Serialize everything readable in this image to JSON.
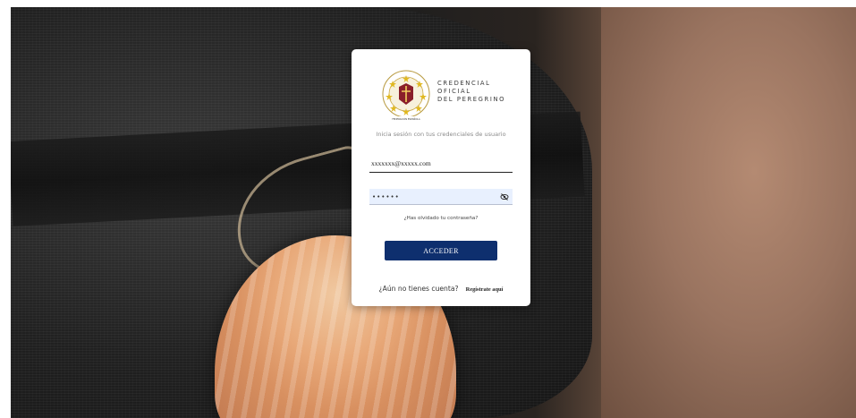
{
  "logo": {
    "line1": "CREDENCIAL",
    "line2": "OFICIAL",
    "line3": "DEL PEREGRINO",
    "seal_icon": "pilgrim-seal-logo"
  },
  "login": {
    "subtitle": "Inicia sesión con tus credenciales de usuario",
    "email_value": "xxxxxxx@xxxxx.com",
    "password_value": "••••••",
    "forgot_password": "¿Has olvidado tu contraseña?",
    "submit_label": "ACCEDER",
    "register_prompt": "¿Aún no tienes cuenta?",
    "register_link": "Regístrate aquí"
  },
  "colors": {
    "primary_button": "#0e2f6e",
    "autofill_bg": "#e8f0fe"
  }
}
